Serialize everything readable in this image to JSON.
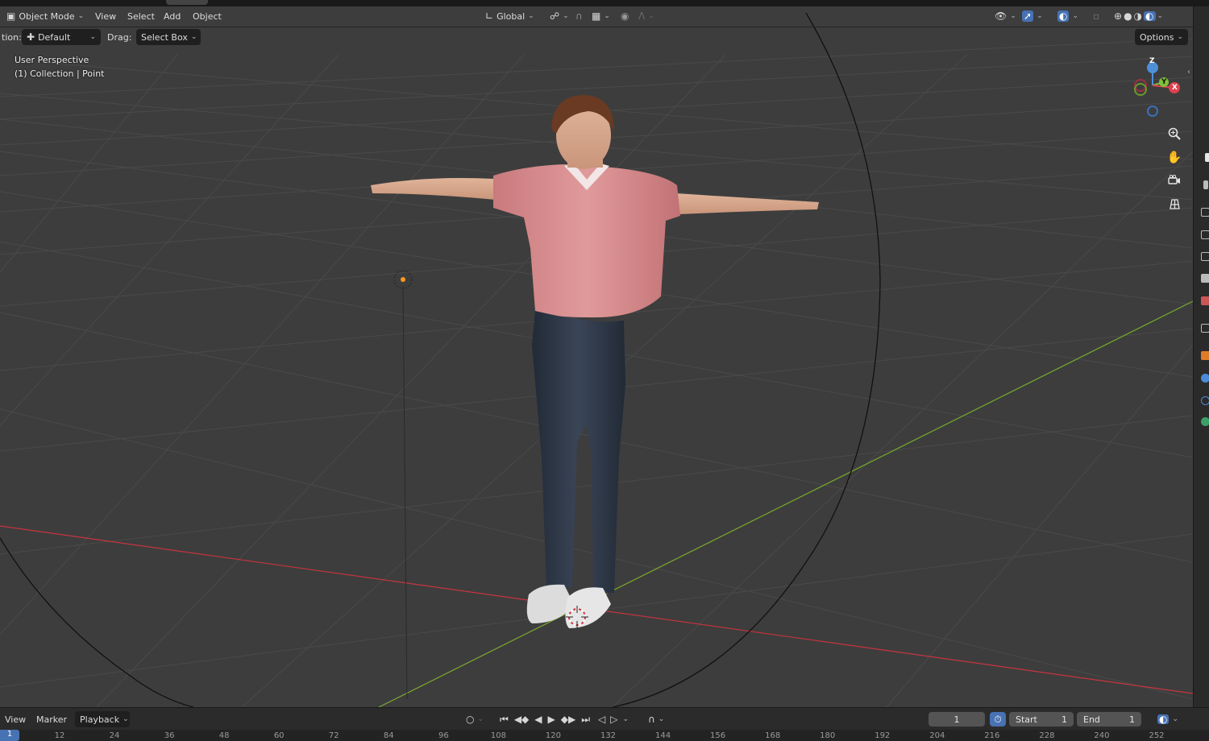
{
  "header": {
    "mode": "Object Mode",
    "menu": [
      "View",
      "Select",
      "Add",
      "Object"
    ],
    "transform_orientation": "Global",
    "options_label": "Options"
  },
  "tool_settings": {
    "orientation_label_partial": "tion:",
    "orientation_value": "Default",
    "drag_label": "Drag:",
    "drag_value": "Select Box"
  },
  "viewport": {
    "view_name": "User Perspective",
    "collection_info": "(1) Collection | Point",
    "gizmo": {
      "z": "Z",
      "y": "Y",
      "x": "X"
    },
    "nav_icons": [
      "zoom-icon",
      "pan-hand-icon",
      "camera-icon",
      "grid-icon"
    ],
    "colors": {
      "background": "#3d3d3d",
      "x_axis": "#c8343f",
      "y_axis": "#7aa82e",
      "shirt": "#d9898b",
      "jeans": "#2b3444"
    }
  },
  "timeline": {
    "menu": [
      "View",
      "Marker",
      "Playback"
    ],
    "current_frame": "1",
    "start_label": "Start",
    "start_value": "1",
    "end_label": "End",
    "end_value": "1",
    "ruler_current": "1",
    "ruler_ticks": [
      "12",
      "24",
      "36",
      "48",
      "60",
      "72",
      "84",
      "96",
      "108",
      "120",
      "132",
      "144",
      "156",
      "168",
      "180",
      "192",
      "204",
      "216",
      "228",
      "240",
      "252"
    ]
  }
}
